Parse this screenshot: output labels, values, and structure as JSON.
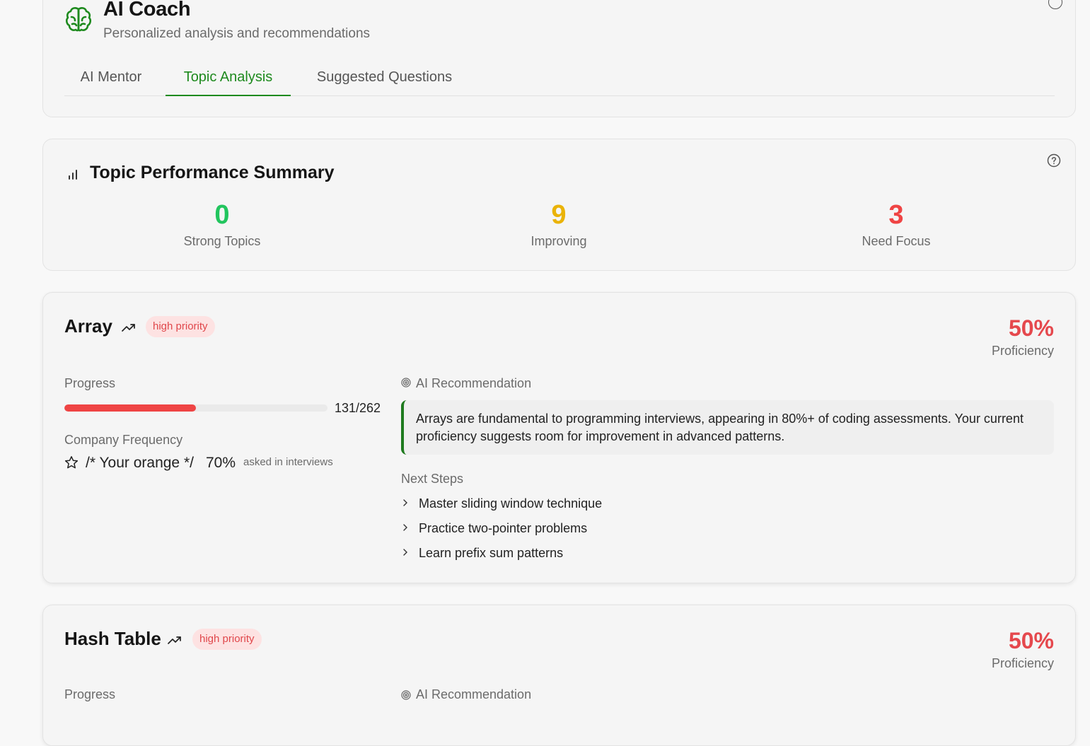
{
  "header": {
    "title": "AI Coach",
    "subtitle": "Personalized analysis and recommendations",
    "icon": "brain-icon",
    "tabs": [
      {
        "label": "AI Mentor",
        "active": false
      },
      {
        "label": "Topic Analysis",
        "active": true
      },
      {
        "label": "Suggested Questions",
        "active": false
      }
    ]
  },
  "summary": {
    "title": "Topic Performance Summary",
    "icon": "bar-chart-icon",
    "stats": [
      {
        "value": "0",
        "label": "Strong Topics",
        "color": "#22c55e"
      },
      {
        "value": "9",
        "label": "Improving",
        "color": "#eab308"
      },
      {
        "value": "3",
        "label": "Need Focus",
        "color": "#ef4444"
      }
    ]
  },
  "topics": [
    {
      "name": "Array",
      "priority": "high priority",
      "proficiency": "50%",
      "proficiency_label": "Proficiency",
      "progress_label": "Progress",
      "progress_count": "131/262",
      "progress_fraction": 0.5,
      "frequency_label": "Company Frequency",
      "frequency_comment": "/* Your orange */",
      "frequency_value": "70%",
      "frequency_note": "asked in interviews",
      "recommendation_label": "AI Recommendation",
      "recommendation": "Arrays are fundamental to programming interviews, appearing in 80%+ of coding assessments. Your current proficiency suggests room for improvement in advanced patterns.",
      "next_steps_label": "Next Steps",
      "next_steps": [
        "Master sliding window technique",
        "Practice two-pointer problems",
        "Learn prefix sum patterns"
      ]
    },
    {
      "name": "Hash Table",
      "priority": "high priority",
      "proficiency": "50%",
      "proficiency_label": "Proficiency",
      "progress_label": "Progress",
      "recommendation_label": "AI Recommendation"
    }
  ],
  "colors": {
    "accent": "#1e8a1e",
    "danger": "#ef4444",
    "badge_bg": "#fde2e2"
  }
}
